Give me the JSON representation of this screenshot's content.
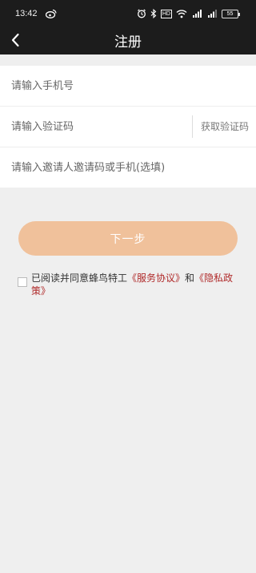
{
  "status_bar": {
    "time": "13:42",
    "hd_label": "HD",
    "battery": "55",
    "icons": [
      "weibo-icon",
      "alarm-icon",
      "bluetooth-icon",
      "hd-icon",
      "wifi-icon",
      "signal-icon",
      "signal-icon",
      "battery-icon"
    ]
  },
  "header": {
    "title": "注册",
    "back_icon": "chevron-left-icon"
  },
  "form": {
    "phone_placeholder": "请输入手机号",
    "code_placeholder": "请输入验证码",
    "get_code_label": "获取验证码",
    "invite_placeholder": "请输入邀请人邀请码或手机(选填)"
  },
  "submit": {
    "label": "下一步"
  },
  "agreement": {
    "checked": false,
    "prefix": "已阅读并同意蜂鸟特工",
    "service_link": "《服务协议》",
    "and": "和",
    "privacy_link": "《隐私政策》"
  },
  "colors": {
    "topbar": "#1c1c1c",
    "background": "#efefef",
    "button": "#f0c19b",
    "link": "#b02a2a"
  }
}
